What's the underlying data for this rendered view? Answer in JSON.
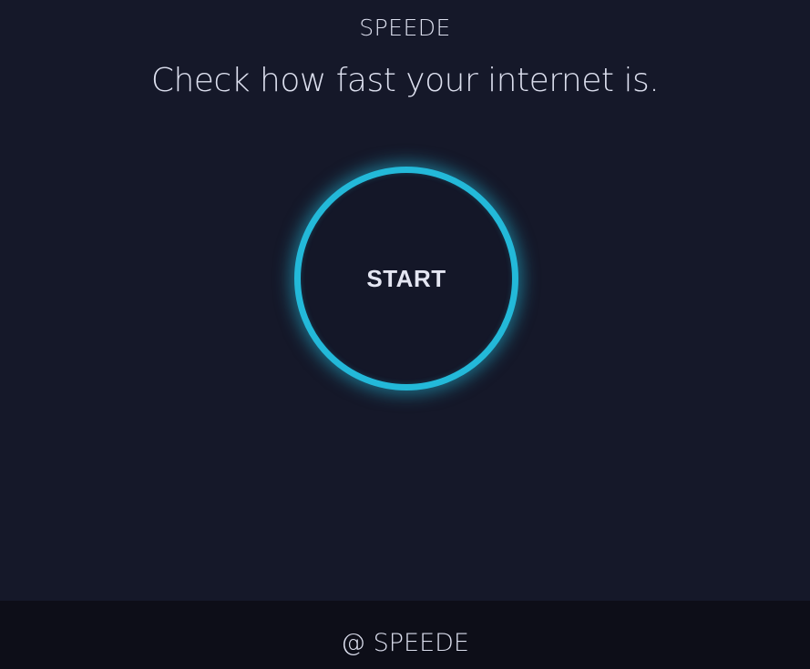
{
  "header": {
    "brand": "SPEEDE",
    "headline": "Check how fast your internet is."
  },
  "main": {
    "start_label": "START"
  },
  "footer": {
    "text": "@ SPEEDE"
  },
  "colors": {
    "background": "#151829",
    "accent": "#23b9d9",
    "footer_background": "#0d0e18",
    "text": "#dcdfee"
  }
}
